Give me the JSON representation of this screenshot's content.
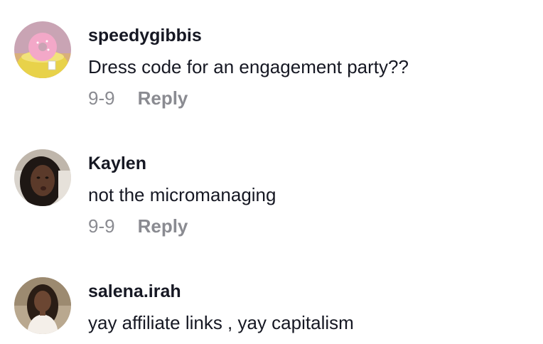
{
  "comments": [
    {
      "username": "speedygibbis",
      "text": "Dress code for an engagement party??",
      "date": "9-9",
      "reply_label": "Reply",
      "avatar_icon": "donut-mug-avatar"
    },
    {
      "username": "Kaylen",
      "text": "not the micromanaging",
      "date": "9-9",
      "reply_label": "Reply",
      "avatar_icon": "profile-photo-avatar"
    },
    {
      "username": "salena.irah",
      "text": "yay affiliate links , yay capitalism",
      "avatar_icon": "profile-photo-avatar"
    }
  ]
}
